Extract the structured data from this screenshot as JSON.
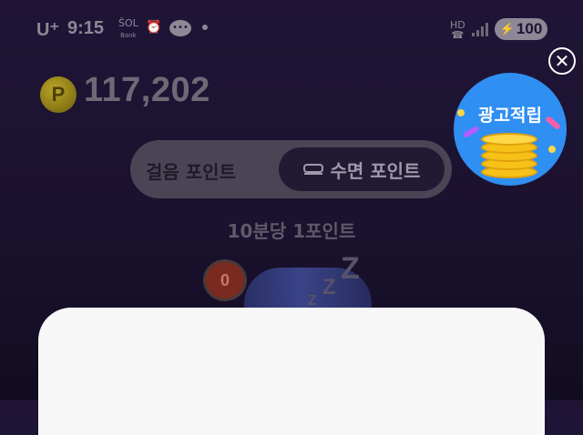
{
  "status_bar": {
    "carrier": "U⁺",
    "time": "9:15",
    "app_icons": [
      "sol-bank-icon",
      "alarm-icon",
      "chat-bubble-icon",
      "dot-icon"
    ],
    "right_icons": [
      "hd-call-icon",
      "signal-icon"
    ],
    "battery": "100"
  },
  "points": {
    "balance": "117,202",
    "coin_symbol": "P"
  },
  "ad_badge": {
    "label": "광고적립"
  },
  "tabs": {
    "walk": "걸음 포인트",
    "sleep": "수면 포인트",
    "selected": "sleep"
  },
  "rate_text": "10분당 1포인트",
  "sleep_counter": "0",
  "zzz": [
    "Z",
    "Z",
    "Z"
  ],
  "close_symbol": "✕",
  "colors": {
    "background": "#1f1436",
    "ad_badge": "#2f8ff2",
    "coin": "#f6c21a",
    "sheet": "#f7f7f7"
  }
}
